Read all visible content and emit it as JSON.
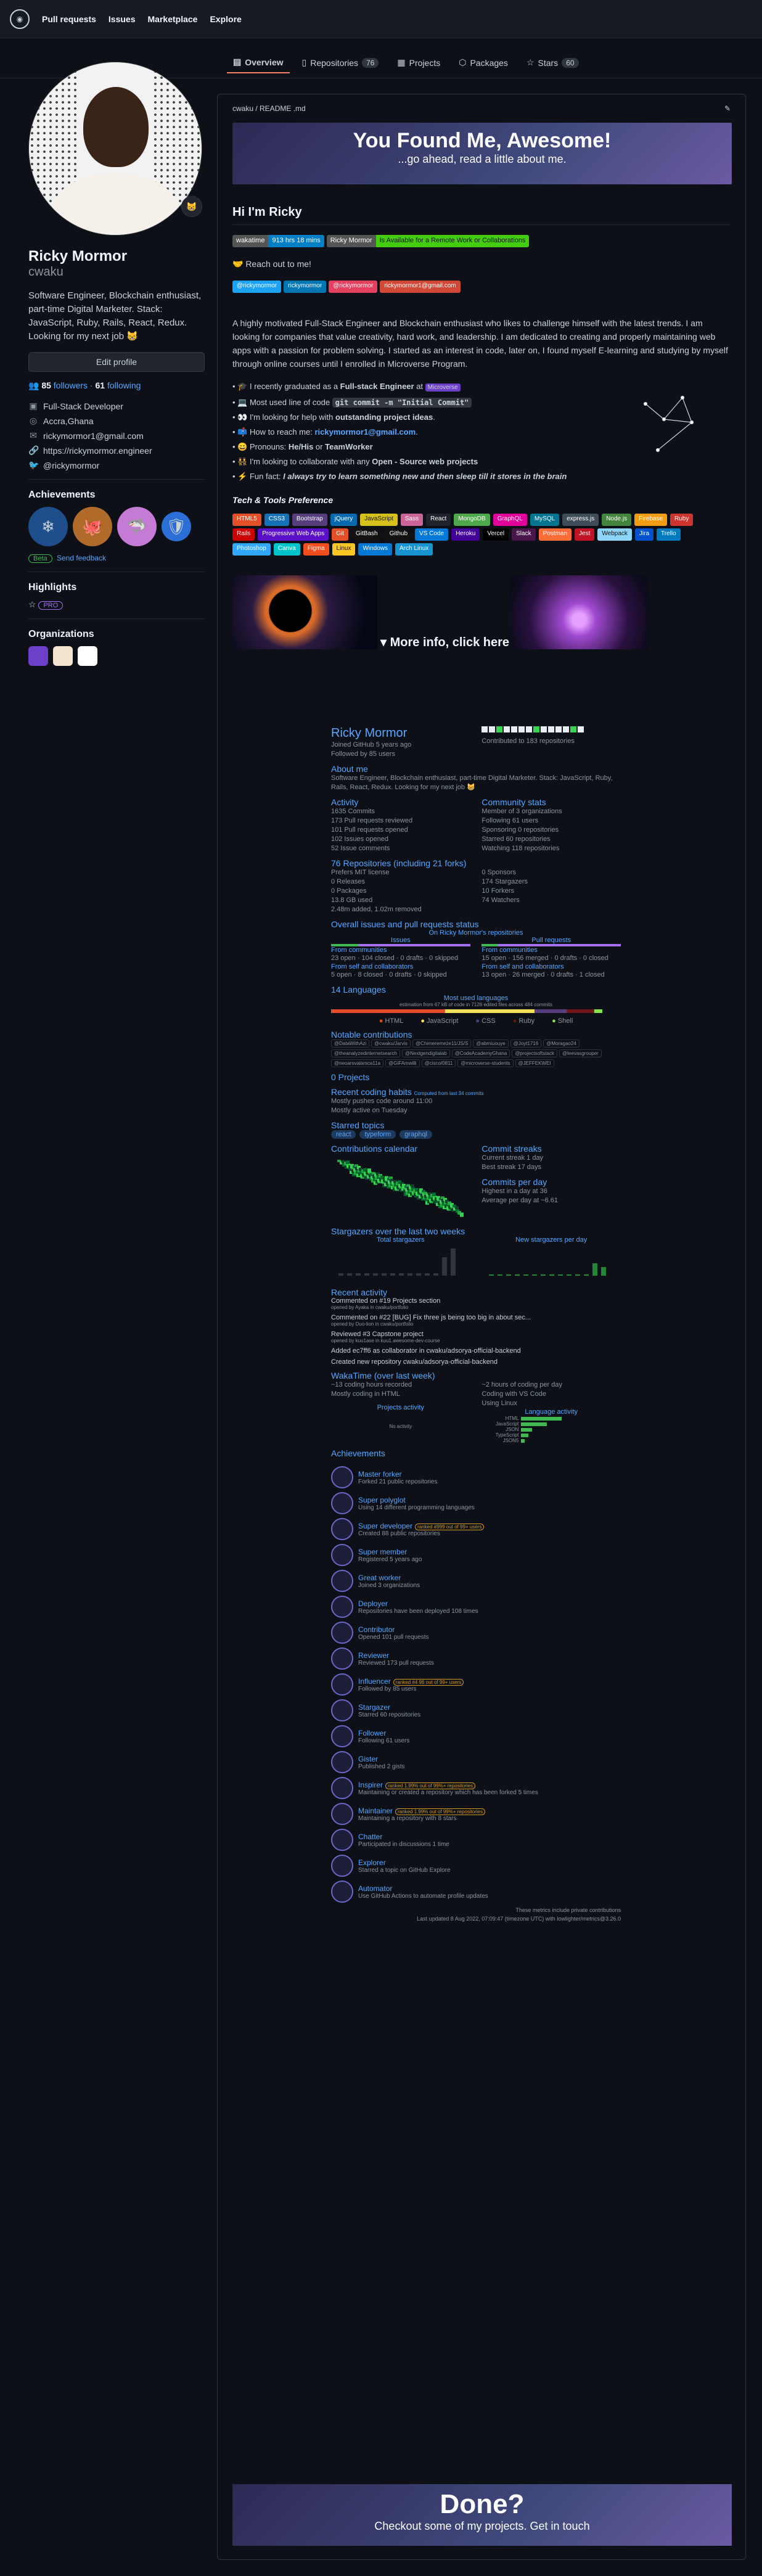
{
  "nav": {
    "pull_requests": "Pull requests",
    "issues": "Issues",
    "marketplace": "Marketplace",
    "explore": "Explore"
  },
  "tabs": [
    {
      "label": "Overview",
      "count": ""
    },
    {
      "label": "Repositories",
      "count": "76"
    },
    {
      "label": "Projects",
      "count": ""
    },
    {
      "label": "Packages",
      "count": ""
    },
    {
      "label": "Stars",
      "count": "60"
    }
  ],
  "profile": {
    "name": "Ricky Mormor",
    "username": "cwaku",
    "bio": "Software Engineer, Blockchain enthusiast, part-time Digital Marketer. Stack: JavaScript, Ruby, Rails, React, Redux. Looking for my next job 😸",
    "edit_label": "Edit profile",
    "followers": "85",
    "followers_label": "followers",
    "following": "61",
    "following_label": "following",
    "details": [
      {
        "icon": "briefcase-icon",
        "text": "Full-Stack Developer"
      },
      {
        "icon": "location-icon",
        "text": "Accra,Ghana"
      },
      {
        "icon": "mail-icon",
        "text": "rickymormor1@gmail.com"
      },
      {
        "icon": "link-icon",
        "text": "https://rickymormor.engineer"
      },
      {
        "icon": "twitter-icon",
        "text": "@rickymormor"
      }
    ],
    "achievements_title": "Achievements",
    "beta_label": "Beta",
    "feedback_label": "Send feedback",
    "highlights_title": "Highlights",
    "pro_label": "PRO",
    "orgs_title": "Organizations"
  },
  "readme": {
    "path": "cwaku / README .md",
    "hero_title": "You Found Me, Awesome!",
    "hero_subtitle": "...go ahead, read a little about me.",
    "hi_heading": "Hi I'm Ricky",
    "status_badges": [
      {
        "l": "wakatime",
        "r": "913 hrs 18 mins",
        "c": "#007ec6"
      },
      {
        "l": "Ricky Mormor",
        "r": "Is Available for a Remote Work or Collaborations",
        "c": "#4c1"
      }
    ],
    "reach_out": "🤝 Reach out to me!",
    "contact_badges": [
      {
        "text": "@rickymormor",
        "c": "#1da1f2"
      },
      {
        "text": "rickymormor",
        "c": "#0077b5"
      },
      {
        "text": "@rickymormor",
        "c": "#e4405f"
      },
      {
        "text": "rickymormor1@gmail.com",
        "c": "#d14836"
      }
    ],
    "intro": "A highly motivated Full-Stack Engineer and Blockchain enthusiast who likes to challenge himself with the latest trends. I am looking for companies that value creativity, hard work, and leadership. I am dedicated to creating and properly maintaining web apps with a passion for problem solving. I started as an interest in code, later on, I found myself E-learning and studying by myself through online courses until I enrolled in Microverse Program.",
    "bullets": [
      {
        "a": "🎓 I recently graduated as a ",
        "b": "Full-stack Engineer",
        "c": " at ",
        "d": "Microverse"
      },
      {
        "a": "💻 Most used line of code ",
        "b": "git commit -m \"Initial Commit\"",
        "c": "",
        "d": ""
      },
      {
        "a": "👀 I'm looking for help with ",
        "b": "outstanding project ideas",
        "c": ".",
        "d": ""
      },
      {
        "a": "📫 How to reach me: ",
        "b": "rickymormor1@gmail.com",
        "c": ".",
        "d": ""
      },
      {
        "a": "😄 Pronouns: ",
        "b": "He/His",
        "c": " or ",
        "d": "TeamWorker"
      },
      {
        "a": "👯 I'm looking to collaborate with any ",
        "b": "Open - Source web projects",
        "c": "",
        "d": ""
      },
      {
        "a": "⚡ Fun fact: ",
        "b": "I always try to learn something new and then sleep till it stores in the brain",
        "c": "",
        "d": ""
      }
    ],
    "tech_title": "Tech & Tools Preference",
    "tech": [
      {
        "t": "HTML5",
        "c": "#e34f26"
      },
      {
        "t": "CSS3",
        "c": "#1572b6"
      },
      {
        "t": "Bootstrap",
        "c": "#563d7c"
      },
      {
        "t": "jQuery",
        "c": "#0769ad"
      },
      {
        "t": "JavaScript",
        "c": "#d6c01a"
      },
      {
        "t": "Sass",
        "c": "#cc6699"
      },
      {
        "t": "React",
        "c": "#20232a"
      },
      {
        "t": "MongoDB",
        "c": "#4ea94b"
      },
      {
        "t": "GraphQL",
        "c": "#e10098"
      },
      {
        "t": "MySQL",
        "c": "#00758f"
      },
      {
        "t": "express.js",
        "c": "#404d59"
      },
      {
        "t": "Node.js",
        "c": "#43853d"
      },
      {
        "t": "Firebase",
        "c": "#f29c11"
      },
      {
        "t": "Ruby",
        "c": "#cc342d"
      },
      {
        "t": "Rails",
        "c": "#cc0000"
      },
      {
        "t": "Progressive Web Apps",
        "c": "#5a0fc8"
      },
      {
        "t": "Git",
        "c": "#e34f26"
      },
      {
        "t": "GitBash",
        "c": "#121011"
      },
      {
        "t": "Github",
        "c": "#121011"
      },
      {
        "t": "VS Code",
        "c": "#0078d7"
      },
      {
        "t": "Heroku",
        "c": "#430098"
      },
      {
        "t": "Vercel",
        "c": "#000000"
      },
      {
        "t": "Slack",
        "c": "#4a154b"
      },
      {
        "t": "Postman",
        "c": "#ff6c37"
      },
      {
        "t": "Jest",
        "c": "#c21325"
      },
      {
        "t": "Webpack",
        "c": "#8dd6f9"
      },
      {
        "t": "Jira",
        "c": "#0052cc"
      },
      {
        "t": "Trello",
        "c": "#0079bf"
      },
      {
        "t": "Photoshop",
        "c": "#31a8ff"
      },
      {
        "t": "Canva",
        "c": "#00c4cc"
      },
      {
        "t": "Figma",
        "c": "#f24e1e"
      },
      {
        "t": "Linux",
        "c": "#fcc624"
      },
      {
        "t": "Windows",
        "c": "#0078d6"
      },
      {
        "t": "Arch Linux",
        "c": "#1793d1"
      }
    ],
    "more_info": "More info, click here",
    "done_title": "Done?",
    "done_subtitle": "Checkout some of my projects. Get in touch"
  },
  "stats": {
    "name": "Ricky Mormor",
    "joined": "Joined GitHub 5 years ago",
    "followed": "Followed by 85 users",
    "contributed": "Contributed to 183 repositories",
    "about_title": "About me",
    "about_text": "Software Engineer, Blockchain enthusiast, part-time Digital Marketer. Stack: JavaScript, Ruby, Rails, React, Redux. Looking for my next job 😸",
    "activity_title": "Activity",
    "activity": [
      "1635 Commits",
      "173 Pull requests reviewed",
      "101 Pull requests opened",
      "102 Issues opened",
      "52 Issue comments"
    ],
    "community_title": "Community stats",
    "community": [
      "Member of 3 organizations",
      "Following 61 users",
      "Sponsoring 0 repositories",
      "Starred 60 repositories",
      "Watching 118 repositories"
    ],
    "repos_title": "76 Repositories (including 21 forks)",
    "repos_left": [
      "Prefers MIT license",
      "0 Releases",
      "0 Packages",
      "13.8 GB used",
      "2.48m added, 1.02m removed"
    ],
    "repos_right": [
      "0 Sponsors",
      "174 Stargazers",
      "10 Forkers",
      "74 Watchers"
    ],
    "overall_title": "Overall issues and pull requests status",
    "on_repos": "On Ricky Mormor's repositories",
    "issues_label": "Issues",
    "prs_label": "Pull requests",
    "from_communities": "From communities",
    "from_self": "From self and collaborators",
    "issues_comm": [
      "23 open",
      "104 closed",
      "0 drafts",
      "0 skipped"
    ],
    "prs_comm": [
      "15 open",
      "156 merged",
      "0 drafts",
      "0 closed"
    ],
    "issues_self": [
      "5 open",
      "8 closed",
      "0 drafts",
      "0 skipped"
    ],
    "prs_self": [
      "13 open",
      "26 merged",
      "0 drafts",
      "1 closed"
    ],
    "languages_title": "14 Languages",
    "most_used": "Most used languages",
    "est_note": "estimation from 67 kB of code in 7126 edited files across 484 commits",
    "lang_legend": [
      "HTML",
      "JavaScript",
      "CSS",
      "Ruby",
      "Shell"
    ],
    "lang_colors": [
      "#e34c26",
      "#f1e05a",
      "#563d7c",
      "#701516",
      "#89e051"
    ],
    "lang_shares": [
      0.42,
      0.33,
      0.12,
      0.1,
      0.03
    ],
    "notable_title": "Notable contributions",
    "notable": [
      "@DataWithAzi",
      "@cwaku/Jarvis",
      "@Chimeremeze11/JS/S",
      "@abmiuouye",
      "@Joyt1716",
      "@Moragao24",
      "@theanalyzedinternetsearch",
      "@Nextgendigitalab",
      "@CodeAcademyGhana",
      "@projectsoftstack",
      "@leevasgrouper",
      "@neoarsvalarsca11a",
      "@GiFAmwilli",
      "@cisco/0811",
      "@microverse-students",
      "@JEFFEKWEI"
    ],
    "projects_title": "0 Projects",
    "coding_title": "Recent coding habits",
    "coding_note": "Computed from last 34 commits",
    "coding": [
      "Mostly pushes code around 11:00",
      "Mostly active on Tuesday"
    ],
    "starred_title": "Starred topics",
    "topics": [
      "react",
      "typeform",
      "graphql"
    ],
    "calendar_title": "Contributions calendar",
    "streaks_title": "Commit streaks",
    "streaks": [
      "Current streak 1 day",
      "Best streak 17 days"
    ],
    "perday_title": "Commits per day",
    "perday": [
      "Highest in a day at 36",
      "Average per day at ~6.61"
    ],
    "stargazers_title": "Stargazers over the last two weeks",
    "total_stargazers": "Total stargazers",
    "new_stargazers": "New stargazers per day",
    "recent_title": "Recent activity",
    "recent": [
      {
        "t": "Commented on #19 Projects section",
        "s": "opened by Ayaka in cwaku/portfolio"
      },
      {
        "t": "Commented on #22 [BUG] Fix three js being too big in about sec...",
        "s": "opened by Duo-lion in cwaku/portfolio"
      },
      {
        "t": "Reviewed #3 Capstone project",
        "s": "opened by kuu1ase in kuu1.awesome-dev-course"
      },
      {
        "t": "Added ec7ff6 as collaborator in cwaku/adsorya-official-backend",
        "s": ""
      },
      {
        "t": "Created new repository cwaku/adsorya-official-backend",
        "s": ""
      }
    ],
    "wakatime_title": "WakaTime (over last week)",
    "wakatime_left": [
      "~13 coding hours recorded",
      "Mostly coding in HTML"
    ],
    "wakatime_right": [
      "~2 hours of coding per day",
      "Coding with VS Code",
      "Using Linux"
    ],
    "project_activity": "Projects activity",
    "language_activity": "Language activity",
    "no_activity": "No activity",
    "waka_langs": [
      "HTML",
      "JavaScript",
      "JSON",
      "TypeScript",
      "JSON5"
    ],
    "waka_vals": [
      0.55,
      0.35,
      0.15,
      0.1,
      0.05
    ],
    "achievements_title": "Achievements",
    "achievements": [
      {
        "t": "Master forker",
        "d": "Forked 21 public repositories",
        "r": ""
      },
      {
        "t": "Super polyglot",
        "d": "Using 14 different programming languages",
        "r": ""
      },
      {
        "t": "Super developer",
        "d": "Created 88 public repositories",
        "r": "ranked #999 out of 99+ users"
      },
      {
        "t": "Super member",
        "d": "Registered 5 years ago",
        "r": ""
      },
      {
        "t": "Great worker",
        "d": "Joined 3 organizations",
        "r": ""
      },
      {
        "t": "Deployer",
        "d": "Repositories have been deployed 108 times",
        "r": ""
      },
      {
        "t": "Contributor",
        "d": "Opened 101 pull requests",
        "r": ""
      },
      {
        "t": "Reviewer",
        "d": "Reviewed 173 pull requests",
        "r": ""
      },
      {
        "t": "Influencer",
        "d": "Followed by 85 users",
        "r": "ranked #4 96 out of 99+ users"
      },
      {
        "t": "Stargazer",
        "d": "Starred 60 repositories",
        "r": ""
      },
      {
        "t": "Follower",
        "d": "Following 61 users",
        "r": ""
      },
      {
        "t": "Gister",
        "d": "Published 2 gists",
        "r": ""
      },
      {
        "t": "Inspirer",
        "d": "Maintaining or created a repository which has been forked 5 times",
        "r": "ranked 1.99% out of 99%+ repositories"
      },
      {
        "t": "Maintainer",
        "d": "Maintaining a repository with 8 stars",
        "r": "ranked 1.99% out of 99%+ repositories"
      },
      {
        "t": "Chatter",
        "d": "Participated in discussions 1 time",
        "r": ""
      },
      {
        "t": "Explorer",
        "d": "Starred a topic on GitHub Explore",
        "r": ""
      },
      {
        "t": "Automator",
        "d": "Use GitHub Actions to automate profile updates",
        "r": ""
      }
    ],
    "footer1": "These metrics include private contributions",
    "footer2": "Last updated 8 Aug 2022, 07:09:47 (timezone UTC) with lowlighter/metrics@3.26.0"
  }
}
